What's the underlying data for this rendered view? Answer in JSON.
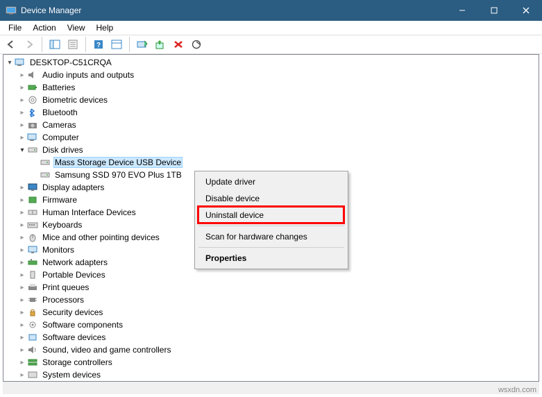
{
  "window": {
    "title": "Device Manager"
  },
  "menu": {
    "file": "File",
    "action": "Action",
    "view": "View",
    "help": "Help"
  },
  "tree": {
    "root": "DESKTOP-C51CRQA",
    "nodes": {
      "audio": "Audio inputs and outputs",
      "batteries": "Batteries",
      "biometric": "Biometric devices",
      "bluetooth": "Bluetooth",
      "cameras": "Cameras",
      "computer": "Computer",
      "disk": "Disk drives",
      "disk_child1": "Mass Storage Device USB Device",
      "disk_child2": "Samsung SSD 970 EVO Plus 1TB",
      "display": "Display adapters",
      "firmware": "Firmware",
      "hid": "Human Interface Devices",
      "keyboards": "Keyboards",
      "mice": "Mice and other pointing devices",
      "monitors": "Monitors",
      "network": "Network adapters",
      "portable": "Portable Devices",
      "printq": "Print queues",
      "processors": "Processors",
      "security": "Security devices",
      "softcomp": "Software components",
      "softdev": "Software devices",
      "sound": "Sound, video and game controllers",
      "storage": "Storage controllers",
      "system": "System devices"
    }
  },
  "context": {
    "update": "Update driver",
    "disable": "Disable device",
    "uninstall": "Uninstall device",
    "scan": "Scan for hardware changes",
    "properties": "Properties"
  },
  "watermark": "wsxdn.com"
}
